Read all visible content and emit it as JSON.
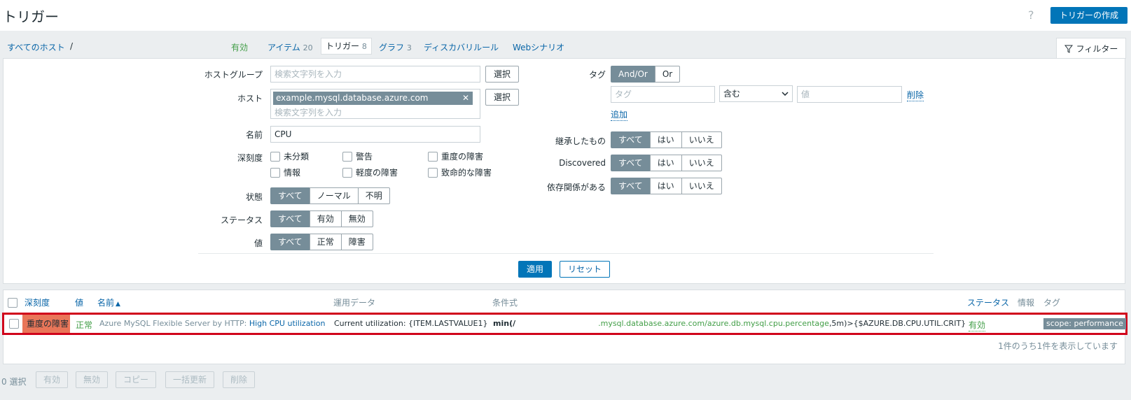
{
  "header": {
    "title": "トリガー",
    "help": "?",
    "create_button": "トリガーの作成"
  },
  "nav": {
    "all_hosts": "すべてのホスト",
    "separator": "/",
    "status": "有効",
    "tabs": [
      {
        "label": "アイテム",
        "count": "20"
      },
      {
        "label": "トリガー",
        "count": "8"
      },
      {
        "label": "グラフ",
        "count": "3"
      },
      {
        "label": "ディスカバリルール",
        "count": ""
      },
      {
        "label": "Webシナリオ",
        "count": ""
      }
    ],
    "filter_tab": "フィルター"
  },
  "filter": {
    "hostgroup_label": "ホストグループ",
    "hostgroup_placeholder": "検索文字列を入力",
    "select_button": "選択",
    "host_label": "ホスト",
    "host_chip": "example.mysql.database.azure.com",
    "host_placeholder": "検索文字列を入力",
    "name_label": "名前",
    "name_value": "CPU",
    "severity_label": "深刻度",
    "severities": [
      "未分類",
      "警告",
      "重度の障害",
      "情報",
      "軽度の障害",
      "致命的な障害"
    ],
    "state_label": "状態",
    "state_options": [
      "すべて",
      "ノーマル",
      "不明"
    ],
    "status_label": "ステータス",
    "status_options": [
      "すべて",
      "有効",
      "無効"
    ],
    "value_label": "値",
    "value_options": [
      "すべて",
      "正常",
      "障害"
    ],
    "tag_label": "タグ",
    "tag_options": [
      "And/Or",
      "Or"
    ],
    "tag_placeholder": "タグ",
    "tag_operator": "含む",
    "tag_value_placeholder": "値",
    "tag_remove": "削除",
    "tag_add": "追加",
    "inherited_label": "継承したもの",
    "discovered_label": "Discovered",
    "dependencies_label": "依存関係がある",
    "yes_no_options": [
      "すべて",
      "はい",
      "いいえ"
    ],
    "apply": "適用",
    "reset": "リセット"
  },
  "table": {
    "columns": {
      "severity": "深刻度",
      "value": "値",
      "name": "名前",
      "sort": "▲",
      "opdata": "運用データ",
      "expression": "条件式",
      "status": "ステータス",
      "info": "情報",
      "tags": "タグ"
    },
    "row": {
      "severity": "重度の障害",
      "value": "正常",
      "name_prefix": "Azure MySQL Flexible Server by HTTP: ",
      "name_link": "High CPU utilization",
      "opdata": "Current utilization: {ITEM.LASTVALUE1}",
      "expr_fn": "min(/",
      "expr_item": ".mysql.database.azure.com/azure.db.mysql.cpu.percentage",
      "expr_rest": ",5m)>{$AZURE.DB.CPU.UTIL.CRIT}",
      "status": "有効",
      "tag": "scope: performance"
    },
    "summary": "1件のうち1件を表示しています"
  },
  "footer": {
    "selected": "0 選択",
    "buttons": [
      "有効",
      "無効",
      "コピー",
      "一括更新",
      "削除"
    ]
  },
  "colors": {
    "accent": "#0a66a8",
    "high_severity": "#e97659",
    "ok_green": "#429e47",
    "highlight_border": "#d0021b"
  }
}
